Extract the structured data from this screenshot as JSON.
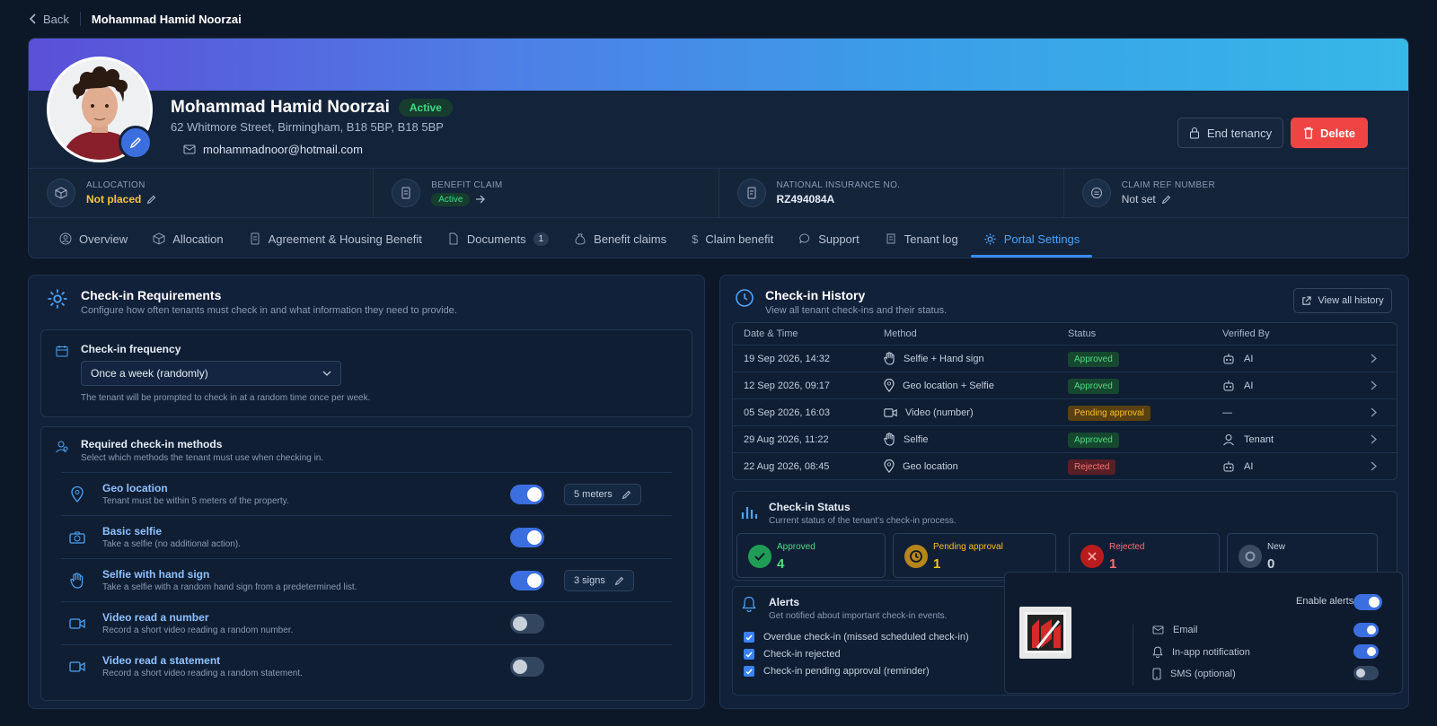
{
  "topbar": {
    "back_label": "Back",
    "title": "Mohammad Hamid Noorzai"
  },
  "profile": {
    "name": "Mohammad Hamid Noorzai",
    "status": "Active",
    "address": "62 Whitmore Street, Birmingham, B18 5BP, B18 5BP",
    "email": "mohammadnoor@hotmail.com",
    "end_tenancy_label": "End tenancy",
    "delete_label": "Delete"
  },
  "info": {
    "allocation": {
      "label": "ALLOCATION",
      "value": "Not placed"
    },
    "benefit_claim": {
      "label": "BENEFIT CLAIM",
      "value": "Active"
    },
    "ni_number": {
      "label": "NATIONAL INSURANCE NO.",
      "value": "RZ494084A"
    },
    "claim_ref": {
      "label": "CLAIM REF NUMBER",
      "value": "Not set"
    }
  },
  "tabs": [
    {
      "label": "Overview"
    },
    {
      "label": "Allocation"
    },
    {
      "label": "Agreement & Housing Benefit"
    },
    {
      "label": "Documents",
      "count": "1"
    },
    {
      "label": "Benefit claims"
    },
    {
      "label": "Claim benefit"
    },
    {
      "label": "Support"
    },
    {
      "label": "Tenant log"
    },
    {
      "label": "Portal Settings",
      "active": true
    }
  ],
  "requirements": {
    "title": "Check-in Requirements",
    "desc": "Configure how often tenants must check in and what information they need to provide.",
    "frequency": {
      "title": "Check-in frequency",
      "selected": "Once a week (randomly)",
      "help": "The tenant will be prompted to check in at a random time once per week."
    },
    "methods": {
      "title": "Required check-in methods",
      "desc": "Select which methods the tenant must use when checking in.",
      "items": [
        {
          "title": "Geo location",
          "desc": "Tenant must be within 5 meters of the property.",
          "enabled": true,
          "chip": "5 meters"
        },
        {
          "title": "Basic selfie",
          "desc": "Take a selfie (no additional action).",
          "enabled": true
        },
        {
          "title": "Selfie with hand sign",
          "desc": "Take a selfie with a random hand sign from a predetermined list.",
          "enabled": true,
          "chip": "3 signs"
        },
        {
          "title": "Video read a number",
          "desc": "Record a short video reading a random number.",
          "enabled": false
        },
        {
          "title": "Video read a statement",
          "desc": "Record a short video reading a random statement.",
          "enabled": false
        }
      ]
    }
  },
  "history": {
    "title": "Check-in History",
    "desc": "View all tenant check-ins and their status.",
    "view_all_label": "View all history",
    "columns": [
      "Date & Time",
      "Method",
      "Status",
      "Verified By"
    ],
    "rows": [
      {
        "date": "19 Sep 2026, 14:32",
        "method": "Selfie + Hand sign",
        "status": "Approved",
        "verified": "AI"
      },
      {
        "date": "12 Sep 2026, 09:17",
        "method": "Geo location + Selfie",
        "status": "Approved",
        "verified": "AI"
      },
      {
        "date": "05 Sep 2026, 16:03",
        "method": "Video (number)",
        "status": "Pending approval",
        "verified": "—"
      },
      {
        "date": "29 Aug 2026, 11:22",
        "method": "Selfie",
        "status": "Approved",
        "verified": "Tenant"
      },
      {
        "date": "22 Aug 2026, 08:45",
        "method": "Geo location",
        "status": "Rejected",
        "verified": "AI"
      }
    ]
  },
  "checkin_status": {
    "title": "Check-in Status",
    "desc": "Current status of the tenant's check-in process.",
    "cards": [
      {
        "label": "Approved",
        "value": "4",
        "color": "#4ade80"
      },
      {
        "label": "Pending approval",
        "value": "1",
        "color": "#fbbf24"
      },
      {
        "label": "Rejected",
        "value": "1",
        "color": "#f87171"
      },
      {
        "label": "New",
        "value": "0",
        "color": "#c5d0de"
      }
    ]
  },
  "alerts": {
    "title": "Alerts",
    "desc": "Get notified about important check-in events.",
    "checks": [
      "Overdue check-in (missed scheduled check-in)",
      "Check-in rejected",
      "Check-in pending approval (reminder)"
    ],
    "enable_label": "Enable alerts",
    "enabled": true,
    "channels": [
      {
        "label": "Email",
        "enabled": true
      },
      {
        "label": "In-app notification",
        "enabled": true
      },
      {
        "label": "SMS (optional)",
        "enabled": false
      }
    ]
  }
}
